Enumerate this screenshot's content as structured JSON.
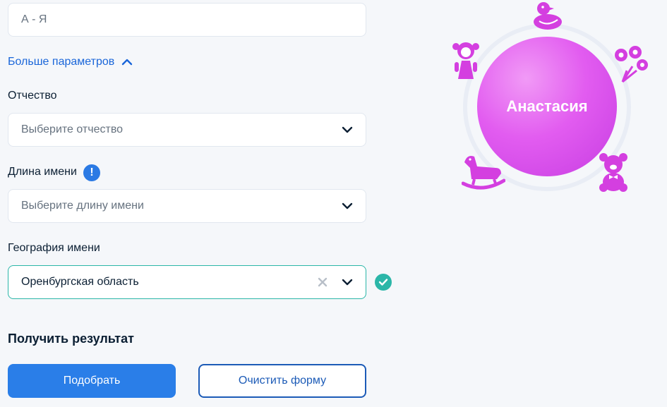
{
  "form": {
    "first_letter": {
      "placeholder": "А - Я"
    },
    "more_params": "Больше параметров",
    "patronymic": {
      "label": "Отчество",
      "placeholder": "Выберите отчество"
    },
    "name_length": {
      "label": "Длина имени",
      "info": "!",
      "placeholder": "Выберите длину имени"
    },
    "geography": {
      "label": "География имени",
      "value": "Оренбургская область"
    },
    "result_title": "Получить результат",
    "submit_label": "Подобрать",
    "clear_label": "Очистить форму"
  },
  "result": {
    "name": "Анастасия"
  },
  "colors": {
    "accent": "#2a7ee8",
    "success": "#2bb6a8",
    "decor": "#d43fe0"
  },
  "icons": [
    "chevron-up-icon",
    "chevron-down-icon",
    "info-icon",
    "clear-icon",
    "check-icon",
    "duck-icon",
    "doll-icon",
    "flowers-icon",
    "rocking-horse-icon",
    "teddy-bear-icon"
  ]
}
